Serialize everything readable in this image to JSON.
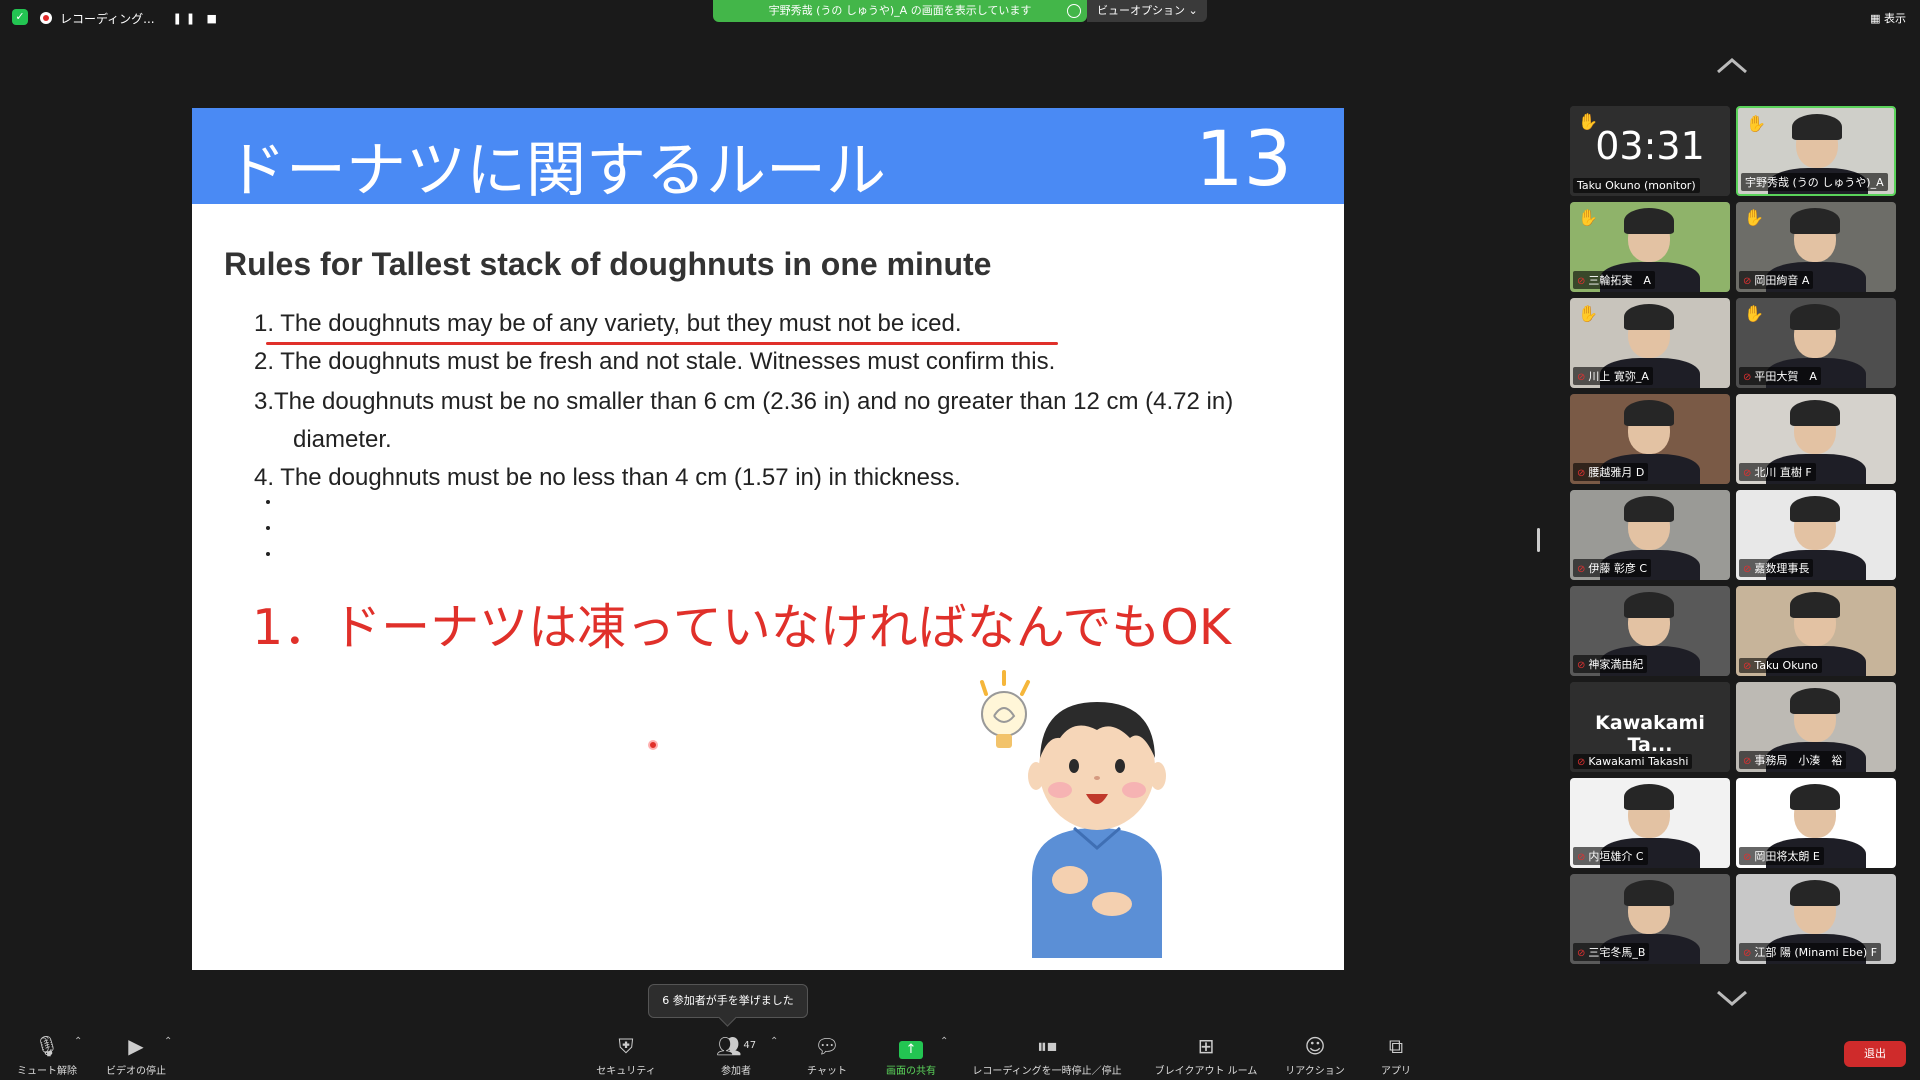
{
  "topbar": {
    "recording_label": "レコーディング...",
    "recording_controls": "❚❚ ■",
    "share_banner": "宇野秀哉 (うの しゅうや)_A の画面を表示しています",
    "view_options": "ビューオプション ⌄",
    "display_label": "表示"
  },
  "slide": {
    "title": "ドーナツに関するルール",
    "number": "13",
    "heading": "Rules for Tallest stack of doughnuts in one minute",
    "rules": [
      "1.  The doughnuts may be of any variety, but they must not be iced.",
      "2.  The doughnuts must be fresh and not stale. Witnesses must confirm this.",
      "3.The doughnuts must be no smaller than 6 cm (2.36 in) and no greater than 12 cm (4.72 in)",
      "diameter.",
      "4.  The doughnuts must be no less than 4 cm (1.57 in) in thickness."
    ],
    "note": "1．ドーナツは凍っていなければなんでもOK"
  },
  "gallery": {
    "tiles": [
      {
        "name": "Taku Okuno (monitor)",
        "big": "03:31",
        "hand": true,
        "muted": false
      },
      {
        "name": "宇野秀哉 (うの しゅうや)_A",
        "hand": true,
        "muted": false,
        "active": true
      },
      {
        "name": "三輪拓実　A",
        "hand": true,
        "muted": true
      },
      {
        "name": "岡田絢音 A",
        "hand": true,
        "muted": true
      },
      {
        "name": "川上 寛弥_A",
        "hand": true,
        "muted": true
      },
      {
        "name": "平田大賀　A",
        "hand": true,
        "muted": true
      },
      {
        "name": "腰越雅月 D",
        "hand": false,
        "muted": true
      },
      {
        "name": "北川 直樹 F",
        "hand": false,
        "muted": true
      },
      {
        "name": "伊藤 彰彦 C",
        "hand": false,
        "muted": true
      },
      {
        "name": "嘉数理事長",
        "hand": false,
        "muted": true
      },
      {
        "name": "神家満由紀",
        "hand": false,
        "muted": true
      },
      {
        "name": "Taku Okuno",
        "hand": false,
        "muted": true
      },
      {
        "name": "Kawakami Takashi",
        "mid": "Kawakami Ta...",
        "hand": false,
        "muted": true
      },
      {
        "name": "事務局　小湊　裕",
        "hand": false,
        "muted": true
      },
      {
        "name": "内垣雄介 C",
        "hand": false,
        "muted": true
      },
      {
        "name": "岡田将太朗 E",
        "hand": false,
        "muted": true
      },
      {
        "name": "三宅冬馬_B",
        "hand": false,
        "muted": true
      },
      {
        "name": "江部 陽 (Minami Ebe) F",
        "hand": false,
        "muted": true
      }
    ]
  },
  "tooltip": "6 参加者が手を挙げました",
  "toolbar": {
    "mute": "ミュート解除",
    "video": "ビデオの停止",
    "security": "セキュリティ",
    "participants": "参加者",
    "participants_count": "47",
    "chat": "チャット",
    "share": "画面の共有",
    "record": "レコーディングを一時停止／停止",
    "breakout": "ブレイクアウト ルーム",
    "reactions": "リアクション",
    "apps": "アプリ",
    "leave": "退出"
  },
  "colors": {
    "slide_header": "#4a8af4",
    "accent_red": "#e0302a",
    "share_green": "#43b649",
    "leave_red": "#cf2b2b"
  }
}
